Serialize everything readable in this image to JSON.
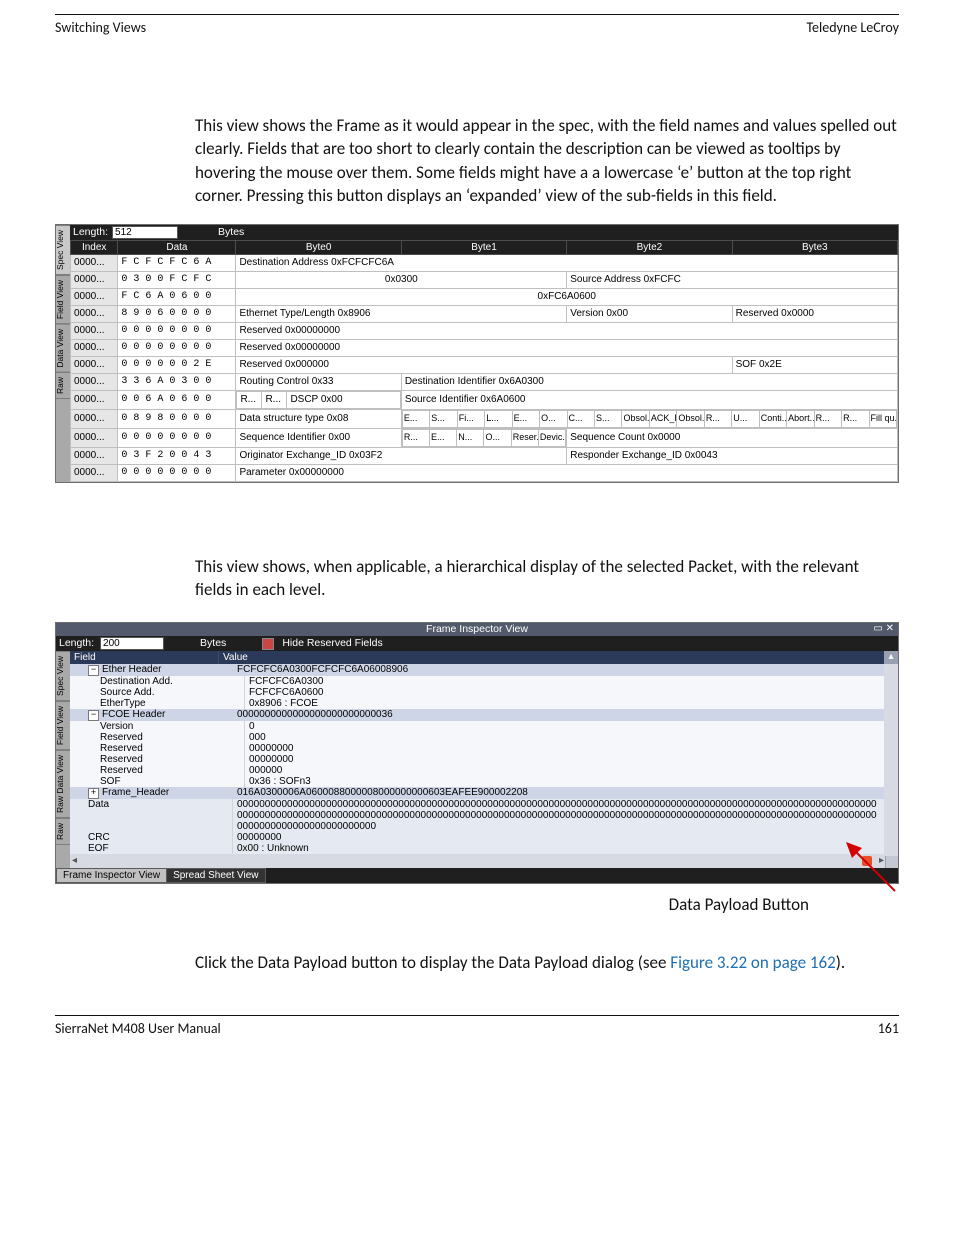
{
  "header": {
    "left": "Switching Views",
    "right": "Teledyne LeCroy"
  },
  "content": {
    "para1": "This view shows the Frame as it would appear in the spec, with the field names and values spelled out clearly. Fields that are too short to clearly contain the description can be viewed as tooltips by hovering the mouse over them. Some fields might have a a lowercase ‘e’ button at the top right corner. Pressing this button displays an ‘expanded’ view of the sub-fields in this field.",
    "para2": "This view shows, when applicable, a hierarchical display of the selected Packet, with the relevant fields in each level.",
    "caption": "Data Payload Button",
    "linksPrefix": "Click the Data Payload button to display the Data Payload dialog (see ",
    "linkText": "Figure 3.22 on page 162",
    "linksSuffix": ")."
  },
  "footer": {
    "left": "SierraNet M408 User Manual",
    "right": "161"
  },
  "figA": {
    "lengthLabel": "Length:",
    "lengthValue": "512",
    "bytesLabel": "Bytes",
    "sideTabs": [
      "Spec View",
      "Field View",
      "Data View",
      "Raw"
    ],
    "cols": {
      "index": "Index",
      "data": "Data",
      "b0": "Byte0",
      "b1": "Byte1",
      "b2": "Byte2",
      "b3": "Byte3"
    },
    "rows": [
      {
        "idx": "0000...",
        "data": "F C  F C  F C  6 A",
        "f0": "Destination Address   0xFCFCFC6A"
      },
      {
        "idx": "0000...",
        "data": "0 3  0 0  F C  F C",
        "f0": "0x0300",
        "f2": "Source Address   0xFCFC"
      },
      {
        "idx": "0000...",
        "data": "F C  6 A  0 6  0 0",
        "f0": "0xFC6A0600"
      },
      {
        "idx": "0000...",
        "data": "8 9  0 6  0 0  0 0",
        "f0": "Ethernet Type/Length   0x8906",
        "f2": "Version   0x00",
        "f3": "Reserved    0x0000"
      },
      {
        "idx": "0000...",
        "data": "0 0  0 0  0 0  0 0",
        "f0": "Reserved    0x00000000"
      },
      {
        "idx": "0000...",
        "data": "0 0  0 0  0 0  0 0",
        "f0": "Reserved    0x00000000"
      },
      {
        "idx": "0000...",
        "data": "0 0  0 0  0 0  2 E",
        "f0": "Reserved    0x000000",
        "sof": "SOF   0x2E"
      },
      {
        "idx": "0000...",
        "data": "3 3  6 A  0 3  0 0",
        "f0": "Routing Control   0x33",
        "f1": "Destination Identifier    0x6A0300"
      },
      {
        "idx": "0000...",
        "data": "0 0  6 A  0 6  0 0",
        "r9a": "R...",
        "r9b": "R...",
        "r9c": "DSCP   0x00",
        "f1": "Source Identifier    0x6A0600"
      },
      {
        "idx": "0000...",
        "data": "0 8  9 8  0 0  0 0",
        "f0": "Data structure type   0x08",
        "flags": [
          "E...",
          "S...",
          "Fi...",
          "L...",
          "E...",
          "O...",
          "C...",
          "S...",
          "Obsol...",
          "ACK_F...",
          "Obsol...",
          "R...",
          "U...",
          "Conti...",
          "Abort...",
          "R...",
          "R...",
          "Fill qu..."
        ]
      },
      {
        "idx": "0000...",
        "data": "0 0  0 0  0 0  0 0",
        "f0": "Sequence Identifier   0x00",
        "r1": [
          "R...",
          "E...",
          "N...",
          "O...",
          "Reser...",
          "Devic..."
        ],
        "f2": "Sequence Count   0x0000"
      },
      {
        "idx": "0000...",
        "data": "0 3  F 2  0 0  4 3",
        "f0": "Originator Exchange_ID   0x03F2",
        "f2": "Responder Exchange_ID   0x0043"
      },
      {
        "idx": "0000...",
        "data": "0 0  0 0  0 0  0 0",
        "f0": "Parameter   0x00000000"
      }
    ]
  },
  "figB": {
    "title": "Frame Inspector View",
    "lengthLabel": "Length:",
    "lengthValue": "200",
    "bytesLabel": "Bytes",
    "hideReserved": "Hide Reserved Fields",
    "sideTabs": [
      "Spec View",
      "Field View",
      "Raw Data View",
      "Raw"
    ],
    "cols": {
      "field": "Field",
      "value": "Value"
    },
    "tree": [
      {
        "k": "Ether Header",
        "v": "FCFCFC6A0300FCFCFC6A06008906",
        "lvl": 0,
        "cls": "dark",
        "exp": "-"
      },
      {
        "k": "Destination Add.",
        "v": "FCFCFC6A0300",
        "lvl": 1,
        "cls": "light"
      },
      {
        "k": "Source Add.",
        "v": "FCFCFC6A0600",
        "lvl": 1,
        "cls": "light"
      },
      {
        "k": "EtherType",
        "v": "0x8906 : FCOE",
        "lvl": 1,
        "cls": "light"
      },
      {
        "k": "FCOE Header",
        "v": "0000000000000000000000000036",
        "lvl": 0,
        "cls": "dark",
        "exp": "-"
      },
      {
        "k": "Version",
        "v": "0",
        "lvl": 1,
        "cls": "light"
      },
      {
        "k": "Reserved",
        "v": "000",
        "lvl": 1,
        "cls": "light"
      },
      {
        "k": "Reserved",
        "v": "00000000",
        "lvl": 1,
        "cls": "light"
      },
      {
        "k": "Reserved",
        "v": "00000000",
        "lvl": 1,
        "cls": "light"
      },
      {
        "k": "Reserved",
        "v": "000000",
        "lvl": 1,
        "cls": "light"
      },
      {
        "k": "SOF",
        "v": "0x36 : SOFn3",
        "lvl": 1,
        "cls": "light"
      },
      {
        "k": "Frame_Header",
        "v": "016A0300006A0600088000008000000000603EAFEE900002208",
        "lvl": 0,
        "cls": "dark",
        "exp": "+"
      },
      {
        "k": "Data",
        "v": "000000000000000000000000000000000000000000000000000000000000000000000000000000000000000000000000000000000000000000000000000000000000000000000000000000000000000000000000000000000000000000000000000000000000000000000000000000000000000000000000000000000000000",
        "lvl": 0,
        "cls": "mid"
      },
      {
        "k": "CRC",
        "v": "00000000",
        "lvl": 0,
        "cls": "mid"
      },
      {
        "k": "EOF",
        "v": "0x00 : Unknown",
        "lvl": 0,
        "cls": "mid"
      }
    ],
    "tabs": {
      "a": "Frame Inspector View",
      "b": "Spread Sheet View"
    }
  }
}
